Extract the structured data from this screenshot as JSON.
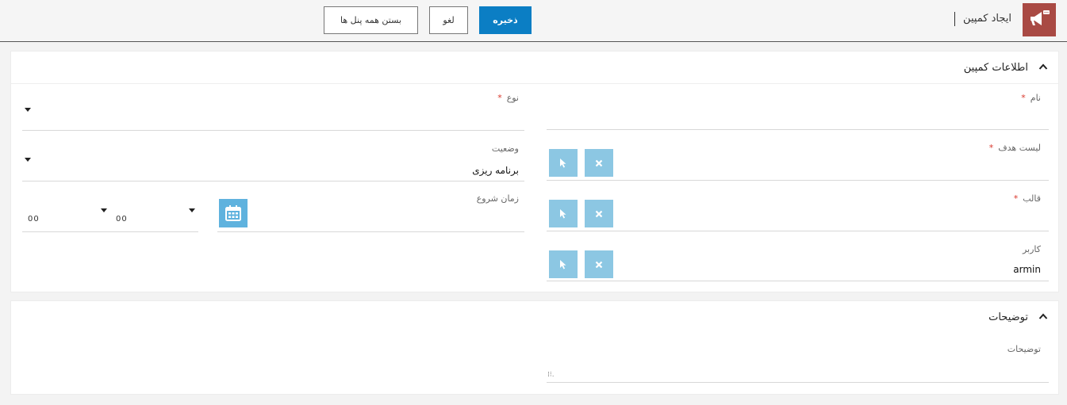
{
  "header": {
    "title": "ایجاد کمپین",
    "save_label": "ذخیره",
    "cancel_label": "لغو",
    "close_all_label": "بستن همه پنل ها",
    "icon": "megaphone-icon",
    "icon_color": "#a94a44"
  },
  "campaign_info": {
    "title": "اطلاعات کمپین",
    "name": {
      "label": "نام",
      "required_mark": "*",
      "value": ""
    },
    "type": {
      "label": "نوع",
      "required_mark": "*",
      "value": ""
    },
    "target_list": {
      "label": "لیست هدف",
      "required_mark": "*",
      "value": ""
    },
    "status": {
      "label": "وضعیت",
      "value": "برنامه ریزی"
    },
    "template": {
      "label": "قالب",
      "required_mark": "*",
      "value": ""
    },
    "start_time": {
      "label": "زمان شروع",
      "hour": "00",
      "minute": "00"
    },
    "user": {
      "label": "کاربر",
      "value": "armin"
    }
  },
  "description_panel": {
    "title": "توضیحات",
    "field_label": "توضیحات",
    "value": ""
  },
  "colors": {
    "primary": "#0b7ec4",
    "select_button": "#8cc7e3",
    "calendar_button": "#5fb2de",
    "required": "#d9362b"
  }
}
